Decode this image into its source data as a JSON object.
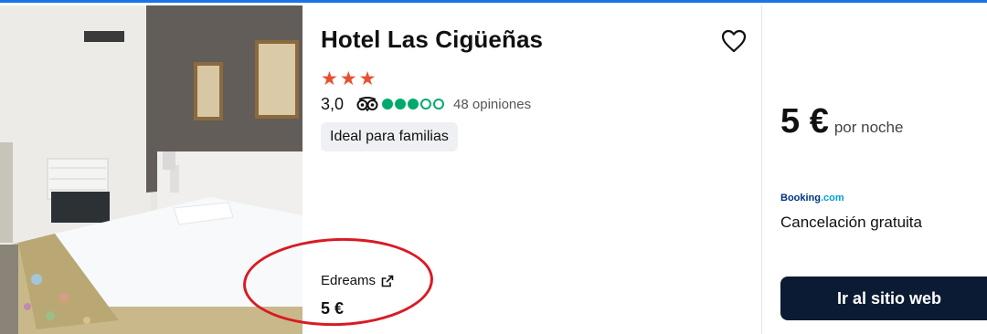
{
  "hotel": {
    "name": "Hotel Las Cigüeñas",
    "stars": 3,
    "rating_value": "3,0",
    "bubbles_full": 3,
    "bubbles_total": 5,
    "reviews_label": "48 opiniones",
    "tag": "Ideal para familias"
  },
  "offer": {
    "provider_name": "Edreams",
    "provider_price": "5 €"
  },
  "best_deal": {
    "price": "5 €",
    "per_night_label": "por noche",
    "provider_logo_text": "Booking",
    "provider_logo_suffix": ".com",
    "cancellation": "Cancelación gratuita",
    "cta_label": "Ir al sitio web"
  },
  "colors": {
    "accent_top_border": "#1a73e8",
    "star": "#e8502f",
    "tripadvisor_green": "#00aa6c",
    "cta_bg": "#0b1b33",
    "annotation_red": "#d81b24"
  },
  "icons": {
    "favorite": "heart-outline-icon",
    "tripadvisor": "owl-icon",
    "external_link": "external-link-icon"
  }
}
